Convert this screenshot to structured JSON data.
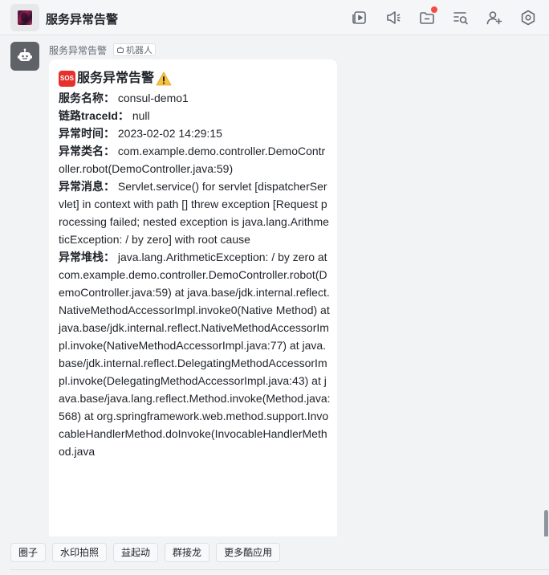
{
  "header": {
    "title": "服务异常告警",
    "toolbar": [
      {
        "name": "video-meeting-icon"
      },
      {
        "name": "announcement-icon"
      },
      {
        "name": "folder-icon"
      },
      {
        "name": "search-list-icon"
      },
      {
        "name": "add-member-icon"
      },
      {
        "name": "settings-icon"
      }
    ],
    "notification_color": "#f54a45"
  },
  "message": {
    "sender": "服务异常告警",
    "bot_tag": "机器人",
    "title": "服务异常告警",
    "title_prefix_icon": "SOS",
    "title_suffix_icon": "warning-icon",
    "fields": [
      {
        "key": "服务名称：",
        "value": "consul-demo1"
      },
      {
        "key": "链路traceId：",
        "value": "null"
      },
      {
        "key": "异常时间：",
        "value": "2023-02-02 14:29:15"
      },
      {
        "key": "异常类名：",
        "value": "com.example.demo.controller.DemoController.robot(DemoController.java:59)"
      },
      {
        "key": "异常消息：",
        "value": "Servlet.service() for servlet [dispatcherServlet] in context with path [] threw exception [Request processing failed; nested exception is java.lang.ArithmeticException: / by zero] with root cause"
      },
      {
        "key": "异常堆栈：",
        "value": "java.lang.ArithmeticException: / by zero at com.example.demo.controller.DemoController.robot(DemoController.java:59) at java.base/jdk.internal.reflect.NativeMethodAccessorImpl.invoke0(Native Method) at java.base/jdk.internal.reflect.NativeMethodAccessorImpl.invoke(NativeMethodAccessorImpl.java:77) at java.base/jdk.internal.reflect.DelegatingMethodAccessorImpl.invoke(DelegatingMethodAccessorImpl.java:43) at java.base/java.lang.reflect.Method.invoke(Method.java:568) at org.springframework.web.method.support.InvocableHandlerMethod.doInvoke(InvocableHandlerMethod.java"
      }
    ]
  },
  "bottom_apps": [
    "圈子",
    "水印拍照",
    "益起动",
    "群接龙",
    "更多酷应用"
  ]
}
